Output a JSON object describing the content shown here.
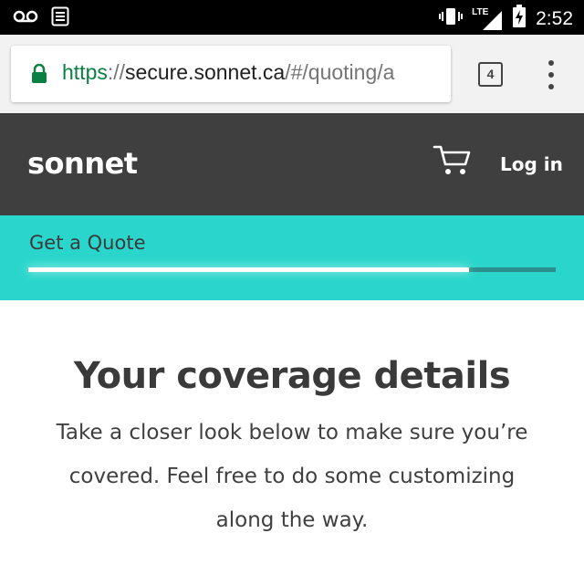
{
  "status_bar": {
    "time": "2:52",
    "network": "LTE",
    "icons": [
      "voicemail-icon",
      "notes-icon",
      "vibrate-icon",
      "signal-icon",
      "battery-charging-icon"
    ]
  },
  "browser": {
    "url": {
      "scheme": "https",
      "separator": "://",
      "host": "secure.sonnet.ca",
      "path": "/#/quoting/a"
    },
    "tab_count": "4"
  },
  "site": {
    "logo": "sonnet",
    "login_label": "Log in"
  },
  "quote": {
    "title": "Get a Quote",
    "progress": 0.835
  },
  "main": {
    "title": "Your coverage details",
    "description": "Take a closer look below to make sure you’re covered. Feel free to do some customizing along the way."
  },
  "colors": {
    "header_bg": "#3f3f3f",
    "accent_teal": "#2ad6cc",
    "progress_track": "#2c8f8b",
    "url_secure_green": "#0b8043"
  }
}
